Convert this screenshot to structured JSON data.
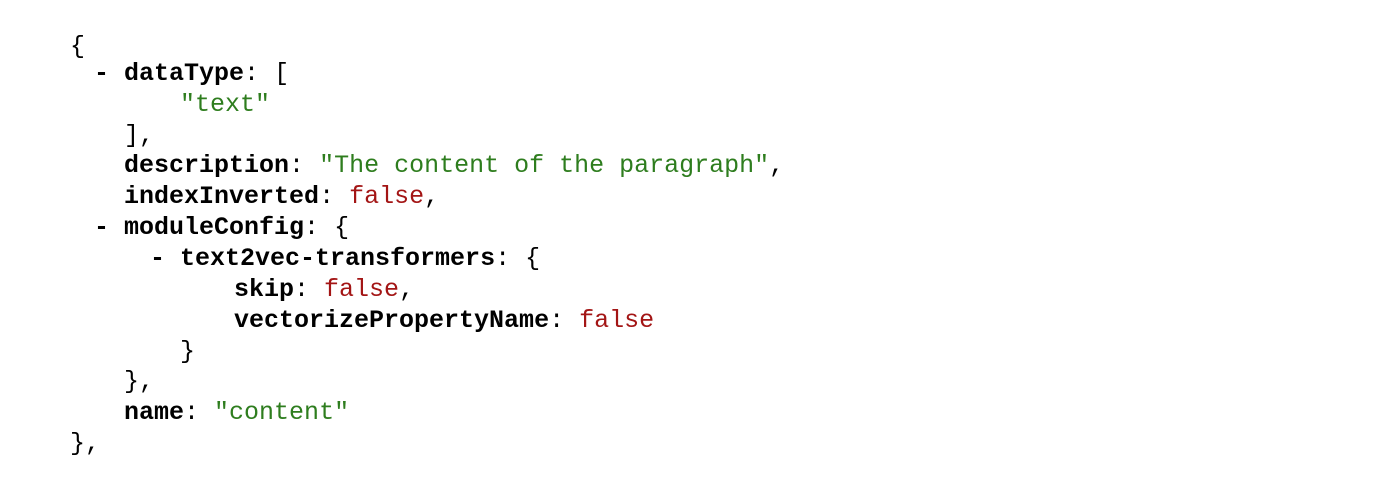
{
  "colors": {
    "key": "#000000",
    "string": "#2e7d1e",
    "boolean": "#a31515",
    "background": "#ffffff"
  },
  "json_view": {
    "collapse_symbol": "-",
    "open_brace": "{",
    "close_brace_comma": "},",
    "data_type": {
      "key": "dataType",
      "open": "[",
      "values": [
        "\"text\""
      ],
      "close": "],"
    },
    "description": {
      "key": "description",
      "value": "\"The content of the paragraph\""
    },
    "index_inverted": {
      "key": "indexInverted",
      "value": "false"
    },
    "module_config": {
      "key": "moduleConfig",
      "open": "{",
      "close": "},",
      "text2vec": {
        "key": "text2vec-transformers",
        "open": "{",
        "close": "}",
        "skip": {
          "key": "skip",
          "value": "false"
        },
        "vectorize_property_name": {
          "key": "vectorizePropertyName",
          "value": "false"
        }
      }
    },
    "name": {
      "key": "name",
      "value": "\"content\""
    }
  }
}
